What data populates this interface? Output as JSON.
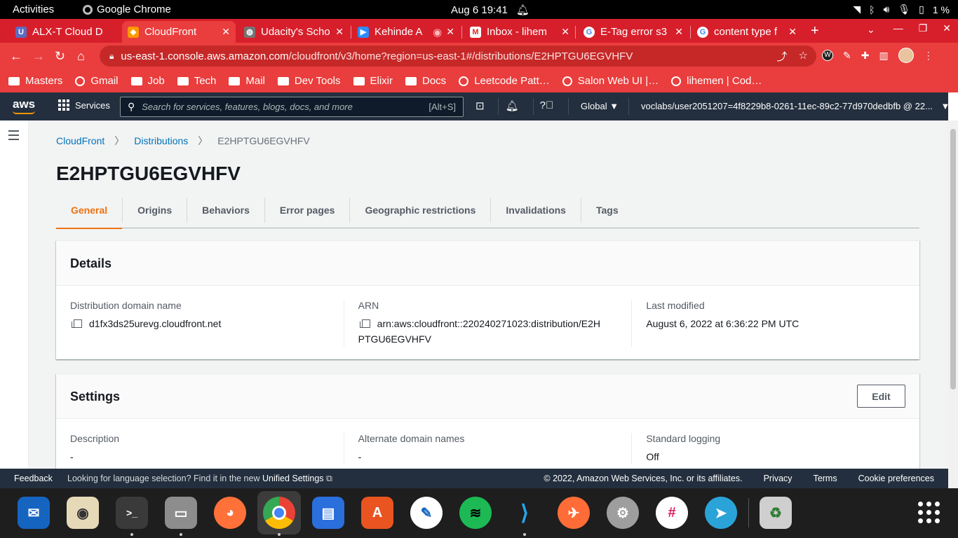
{
  "system_bar": {
    "activities": "Activities",
    "app_name": "Google Chrome",
    "clock": "Aug 6  19:41",
    "battery": "1 %"
  },
  "browser": {
    "tabs": [
      {
        "title": "ALX-T Cloud D",
        "fav_color": "#5c6bc0",
        "fav_glyph": "U"
      },
      {
        "title": "CloudFront",
        "fav_color": "#ff9900",
        "fav_glyph": "◆",
        "active": true
      },
      {
        "title": "Udacity's Scho",
        "fav_color": "#757575",
        "fav_glyph": "◍"
      },
      {
        "title": "Kehinde A",
        "fav_color": "#2d8cff",
        "fav_glyph": "▶"
      },
      {
        "title": "Inbox - lihem",
        "fav_color": "#ffffff",
        "fav_glyph": "M"
      },
      {
        "title": "E-Tag error s3",
        "fav_color": "#ffffff",
        "fav_glyph": "G"
      },
      {
        "title": "content type f",
        "fav_color": "#ffffff",
        "fav_glyph": "G"
      }
    ],
    "url_host": "us-east-1.console.aws.amazon.com",
    "url_path": "/cloudfront/v3/home?region=us-east-1#/distributions/E2HPTGU6EGVHFV",
    "bookmarks": [
      {
        "label": "Masters",
        "type": "folder"
      },
      {
        "label": "Gmail",
        "type": "site"
      },
      {
        "label": "Job",
        "type": "folder"
      },
      {
        "label": "Tech",
        "type": "folder"
      },
      {
        "label": "Mail",
        "type": "folder"
      },
      {
        "label": "Dev Tools",
        "type": "folder"
      },
      {
        "label": "Elixir",
        "type": "folder"
      },
      {
        "label": "Docs",
        "type": "folder"
      },
      {
        "label": "Leetcode Patt…",
        "type": "site"
      },
      {
        "label": "Salon Web UI |…",
        "type": "site"
      },
      {
        "label": "lihemen | Cod…",
        "type": "site"
      }
    ]
  },
  "aws_nav": {
    "logo": "aws",
    "services": "Services",
    "search_placeholder": "Search for services, features, blogs, docs, and more",
    "search_shortcut": "[Alt+S]",
    "region": "Global",
    "account": "voclabs/user2051207=4f8229b8-0261-11ec-89c2-77d970dedbfb @ 22..."
  },
  "breadcrumb": {
    "root": "CloudFront",
    "section": "Distributions",
    "current": "E2HPTGU6EGVHFV"
  },
  "page_title": "E2HPTGU6EGVHFV",
  "tabs": [
    "General",
    "Origins",
    "Behaviors",
    "Error pages",
    "Geographic restrictions",
    "Invalidations",
    "Tags"
  ],
  "details": {
    "heading": "Details",
    "domain_label": "Distribution domain name",
    "domain_value": "d1fx3ds25urevg.cloudfront.net",
    "arn_label": "ARN",
    "arn_value_line1": "arn:aws:cloudfront::220240271023:distribution/E2H",
    "arn_value_line2": "PTGU6EGVHFV",
    "modified_label": "Last modified",
    "modified_value": "August 6, 2022 at 6:36:22 PM UTC"
  },
  "settings": {
    "heading": "Settings",
    "edit": "Edit",
    "description_label": "Description",
    "description_value": "-",
    "alt_domains_label": "Alternate domain names",
    "alt_domains_value": "-",
    "logging_label": "Standard logging",
    "logging_value": "Off"
  },
  "footer": {
    "feedback": "Feedback",
    "message": "Looking for language selection? Find it in the new",
    "unified": "Unified Settings",
    "copyright": "© 2022, Amazon Web Services, Inc. or its affiliates.",
    "privacy": "Privacy",
    "terms": "Terms",
    "cookies": "Cookie preferences"
  },
  "dock": [
    {
      "name": "thunderbird-icon",
      "color": "#1565c0",
      "glyph": "✉"
    },
    {
      "name": "rhythmbox-icon",
      "color": "#e6d9b8",
      "glyph": "◉"
    },
    {
      "name": "terminal-icon",
      "color": "#3a3a3a",
      "glyph": ">_"
    },
    {
      "name": "files-icon",
      "color": "#8d8d8d",
      "glyph": "▭"
    },
    {
      "name": "firefox-icon",
      "color": "#ff7139",
      "glyph": "◕"
    },
    {
      "name": "chrome-icon",
      "color": "#4285f4",
      "glyph": "◎"
    },
    {
      "name": "writer-icon",
      "color": "#2a6fdb",
      "glyph": "▤"
    },
    {
      "name": "software-icon",
      "color": "#e95420",
      "glyph": "A"
    },
    {
      "name": "inkscape-icon",
      "color": "#ffffff",
      "glyph": "✎"
    },
    {
      "name": "spotify-icon",
      "color": "#1db954",
      "glyph": "≋"
    },
    {
      "name": "vscode-icon",
      "color": "#1e1e1e",
      "glyph": "⟩"
    },
    {
      "name": "postman-icon",
      "color": "#ff6c37",
      "glyph": "✈"
    },
    {
      "name": "settings-icon",
      "color": "#9e9e9e",
      "glyph": "⚙"
    },
    {
      "name": "slack-icon",
      "color": "#ffffff",
      "glyph": "#"
    },
    {
      "name": "telegram-icon",
      "color": "#2aa4d8",
      "glyph": "➤"
    },
    {
      "name": "trash-icon",
      "color": "#cfcfcf",
      "glyph": "♻"
    }
  ]
}
